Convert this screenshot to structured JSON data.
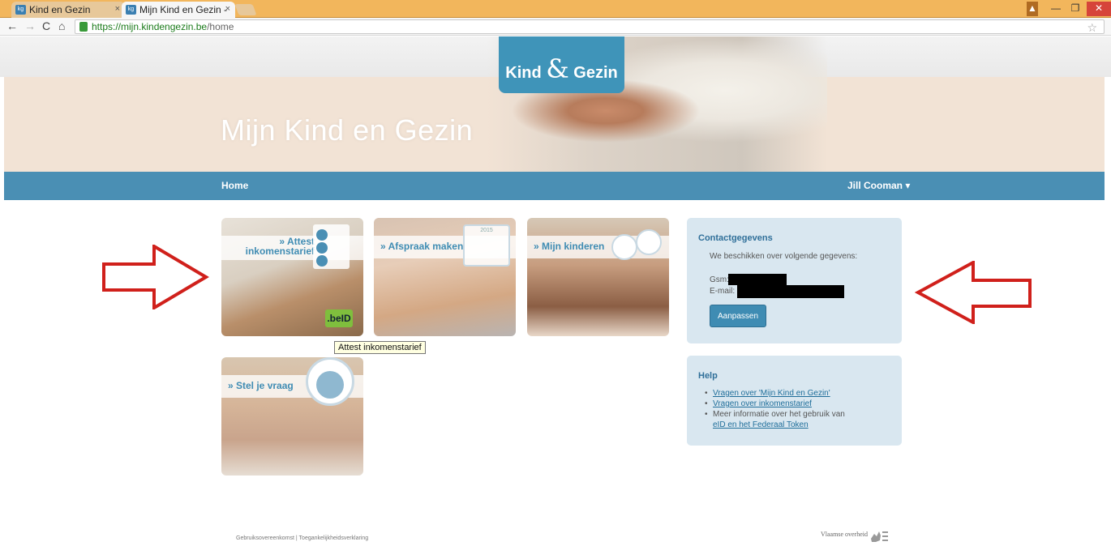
{
  "browser": {
    "tabs": [
      {
        "label": "Kind en Gezin",
        "active": false
      },
      {
        "label": "Mijn Kind en Gezin -",
        "active": true
      }
    ],
    "tab_close": "×",
    "url_host": "https://mijn.kindengezin.be",
    "url_path": "/home"
  },
  "header": {
    "logo_left": "Kind",
    "logo_amp": "&",
    "logo_right": "Gezin",
    "title": "Mijn Kind en Gezin"
  },
  "nav": {
    "home": "Home",
    "user": "Jill Cooman ▾"
  },
  "tiles": [
    {
      "label": "» Attest inkomenstarief"
    },
    {
      "label": "» Afspraak maken"
    },
    {
      "label": "» Mijn kinderen"
    },
    {
      "label": "» Stel je vraag"
    }
  ],
  "tile_extras": {
    "beid": ".beID",
    "calendar_year": "2015"
  },
  "tooltip": "Attest inkomenstarief",
  "contact": {
    "title": "Contactgegevens",
    "text": "We beschikken over volgende gegevens:",
    "gsm_label": "Gsm:",
    "email_label": "E-mail:",
    "button": "Aanpassen"
  },
  "help": {
    "title": "Help",
    "items": [
      {
        "link": "Vragen over 'Mijn Kind en Gezin'"
      },
      {
        "link": "Vragen over inkomenstarief"
      },
      {
        "text": "Meer informatie over het gebruik van",
        "link": "eID en het Federaal Token"
      }
    ]
  },
  "footer": {
    "links": "Gebruiksovereenkomst | Toegankelijkheidsverklaring",
    "brand": "Vlaamse overheid"
  },
  "colors": {
    "accent": "#4a8fb4",
    "panel": "#d9e7f0",
    "arrow": "#d0201b",
    "logo_bg": "#3f94b9"
  }
}
